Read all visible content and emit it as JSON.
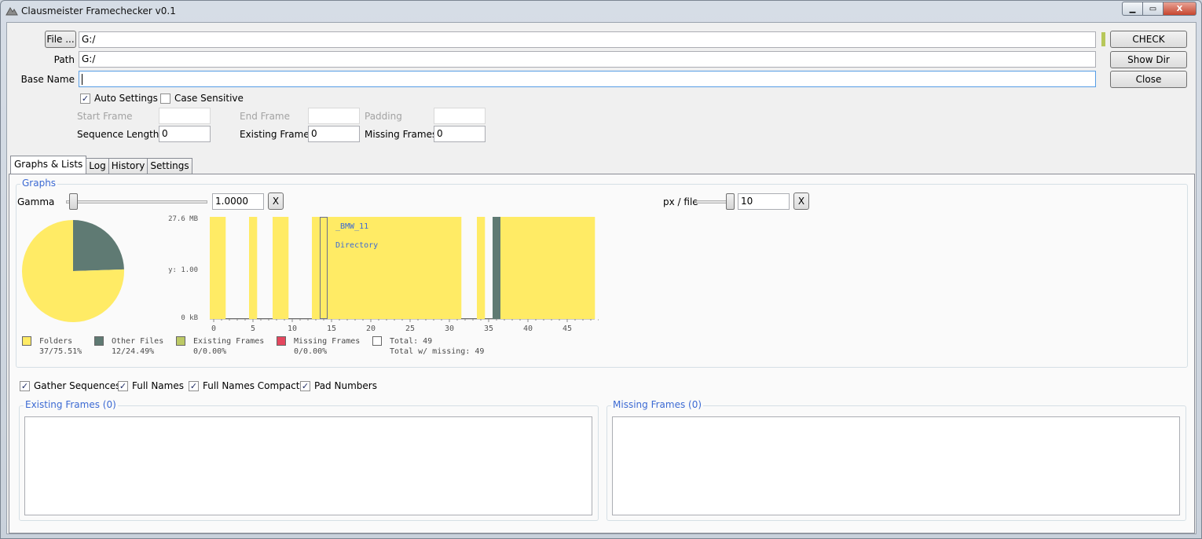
{
  "window": {
    "title": "Clausmeister Framechecker v0.1",
    "controls": {
      "minimize": "▁",
      "maximize": "▭",
      "close": "X"
    }
  },
  "top": {
    "file_button": "File ...",
    "file_value": "G:/",
    "path_label": "Path",
    "path_value": "G:/",
    "basename_label": "Base Name",
    "basename_value": "",
    "check_button": "CHECK",
    "showdir_button": "Show Dir",
    "close_button": "Close"
  },
  "options": {
    "auto_settings": "Auto Settings",
    "case_sensitive": "Case Sensitive",
    "start_frame": "Start Frame",
    "end_frame": "End Frame",
    "padding": "Padding",
    "sequence_length": "Sequence Length",
    "sequence_length_value": "0",
    "existing_frames": "Existing Frames",
    "existing_frames_value": "0",
    "missing_frames": "Missing Frames",
    "missing_frames_value": "0"
  },
  "tabs": [
    "Graphs & Lists",
    "Log",
    "History",
    "Settings"
  ],
  "graphs": {
    "group_title": "Graphs",
    "gamma_label": "Gamma",
    "gamma_value": "1.0000",
    "gamma_reset": "X",
    "pxfile_label": "px / file",
    "pxfile_value": "10",
    "pxfile_reset": "X",
    "gamma_level": 0.05,
    "pxfile_level": 0.9
  },
  "colors": {
    "folders": "#ffeb65",
    "other_files": "#5f7a73",
    "existing_frames": "#bcc965",
    "missing_frames": "#e4465e",
    "total": "#ffffff",
    "accent": "#3c6ad3"
  },
  "chart_data": [
    {
      "type": "pie",
      "slices": [
        {
          "label": "Folders",
          "value": 37
        },
        {
          "label": "Other Files",
          "value": 12
        }
      ]
    },
    {
      "type": "bar",
      "y_ticks": [
        "27.6 MB",
        "y: 1.00",
        "0 kB"
      ],
      "x_ticks": [
        0,
        5,
        10,
        15,
        20,
        25,
        30,
        35,
        40,
        45
      ],
      "xlim": [
        0,
        49
      ],
      "bars": [
        {
          "x": 0,
          "kind": "folder"
        },
        {
          "x": 1,
          "kind": "folder"
        },
        {
          "x": 2,
          "kind": "empty"
        },
        {
          "x": 3,
          "kind": "empty"
        },
        {
          "x": 4,
          "kind": "empty"
        },
        {
          "x": 5,
          "kind": "folder"
        },
        {
          "x": 6,
          "kind": "empty"
        },
        {
          "x": 7,
          "kind": "empty"
        },
        {
          "x": 8,
          "kind": "folder"
        },
        {
          "x": 9,
          "kind": "folder"
        },
        {
          "x": 10,
          "kind": "empty"
        },
        {
          "x": 11,
          "kind": "empty"
        },
        {
          "x": 12,
          "kind": "empty"
        },
        {
          "x": 13,
          "kind": "folder"
        },
        {
          "x": 14,
          "kind": "folder"
        },
        {
          "x": 15,
          "kind": "folder"
        },
        {
          "x": 16,
          "kind": "folder"
        },
        {
          "x": 17,
          "kind": "folder"
        },
        {
          "x": 18,
          "kind": "folder"
        },
        {
          "x": 19,
          "kind": "folder"
        },
        {
          "x": 20,
          "kind": "folder"
        },
        {
          "x": 21,
          "kind": "folder"
        },
        {
          "x": 22,
          "kind": "folder"
        },
        {
          "x": 23,
          "kind": "folder"
        },
        {
          "x": 24,
          "kind": "folder"
        },
        {
          "x": 25,
          "kind": "folder"
        },
        {
          "x": 26,
          "kind": "folder"
        },
        {
          "x": 27,
          "kind": "folder"
        },
        {
          "x": 28,
          "kind": "folder"
        },
        {
          "x": 29,
          "kind": "folder"
        },
        {
          "x": 30,
          "kind": "folder"
        },
        {
          "x": 31,
          "kind": "folder"
        },
        {
          "x": 32,
          "kind": "empty"
        },
        {
          "x": 33,
          "kind": "empty"
        },
        {
          "x": 34,
          "kind": "folder"
        },
        {
          "x": 35,
          "kind": "empty"
        },
        {
          "x": 36,
          "kind": "other"
        },
        {
          "x": 37,
          "kind": "folder"
        },
        {
          "x": 38,
          "kind": "folder"
        },
        {
          "x": 39,
          "kind": "folder"
        },
        {
          "x": 40,
          "kind": "folder"
        },
        {
          "x": 41,
          "kind": "folder"
        },
        {
          "x": 42,
          "kind": "folder"
        },
        {
          "x": 43,
          "kind": "folder"
        },
        {
          "x": 44,
          "kind": "folder"
        },
        {
          "x": 45,
          "kind": "folder"
        },
        {
          "x": 46,
          "kind": "folder"
        },
        {
          "x": 47,
          "kind": "folder"
        },
        {
          "x": 48,
          "kind": "folder"
        }
      ],
      "highlight_index": 14,
      "tooltip": [
        "_BMW_11",
        "Directory"
      ]
    }
  ],
  "legend": [
    {
      "name": "Folders",
      "value": "37/75.51%",
      "color_key": "folders"
    },
    {
      "name": "Other Files",
      "value": "12/24.49%",
      "color_key": "other_files"
    },
    {
      "name": "Existing Frames",
      "value": "0/0.00%",
      "color_key": "existing_frames"
    },
    {
      "name": "Missing Frames",
      "value": "0/0.00%",
      "color_key": "missing_frames"
    },
    {
      "name": "Total: 49",
      "value": "Total w/ missing: 49",
      "color_key": "total"
    }
  ],
  "list_options": {
    "gather_sequences": "Gather Sequences",
    "full_names": "Full Names",
    "full_names_compact": "Full Names Compact",
    "pad_numbers": "Pad Numbers"
  },
  "lists": {
    "existing_title": "Existing Frames (0)",
    "missing_title": "Missing Frames (0)"
  }
}
